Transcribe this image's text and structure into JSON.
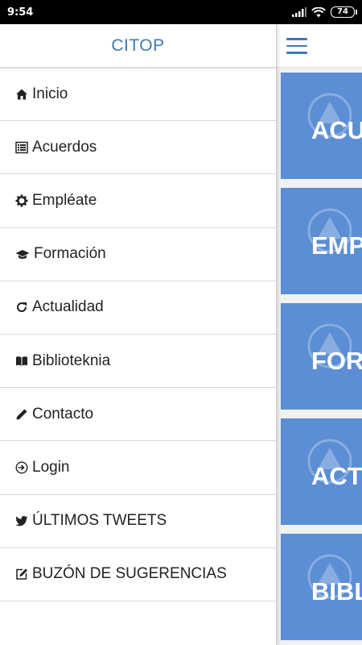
{
  "status_bar": {
    "time": "9:54",
    "battery": "74"
  },
  "drawer": {
    "title": "CITOP",
    "items": [
      {
        "label": "Inicio",
        "icon": "home-icon"
      },
      {
        "label": "Acuerdos",
        "icon": "list-icon"
      },
      {
        "label": "Empléate",
        "icon": "gear-icon"
      },
      {
        "label": "Formación",
        "icon": "graduation-cap-icon"
      },
      {
        "label": "Actualidad",
        "icon": "refresh-icon"
      },
      {
        "label": "Biblioteknia",
        "icon": "book-icon"
      },
      {
        "label": "Contacto",
        "icon": "pencil-icon"
      },
      {
        "label": "Login",
        "icon": "login-icon"
      },
      {
        "label": "ÚLTIMOS TWEETS",
        "icon": "twitter-icon"
      },
      {
        "label": "BUZÓN DE SUGERENCIAS",
        "icon": "edit-icon"
      }
    ]
  },
  "main": {
    "tiles": [
      {
        "label": "ACU"
      },
      {
        "label": "EMP"
      },
      {
        "label": "FOR"
      },
      {
        "label": "ACTU"
      },
      {
        "label": "BIBL"
      }
    ]
  },
  "colors": {
    "accent": "#3f79b4",
    "tile": "#5b8ed4"
  }
}
